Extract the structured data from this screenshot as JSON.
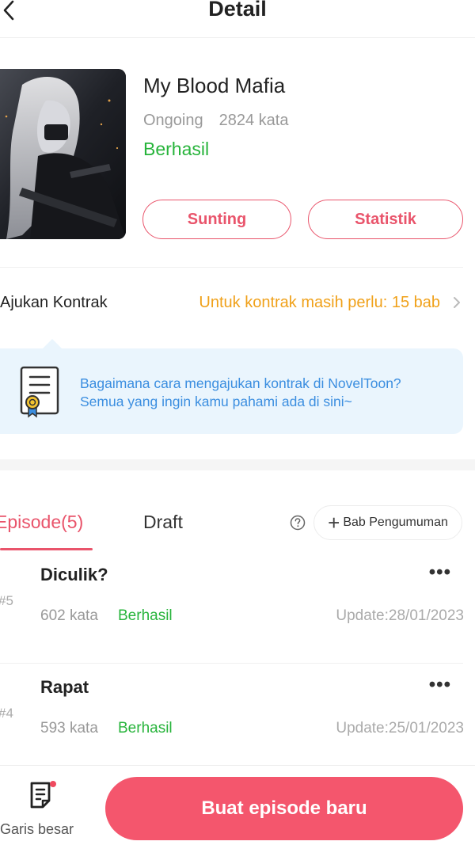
{
  "header": {
    "title": "Detail"
  },
  "book": {
    "title": "My Blood Mafia",
    "state": "Ongoing",
    "word_count": "2824 kata",
    "status": "Berhasil",
    "edit_label": "Sunting",
    "stats_label": "Statistik"
  },
  "contract": {
    "label": "Ajukan Kontrak",
    "requirement": "Untuk kontrak masih perlu: 15 bab"
  },
  "info": {
    "line1": "Bagaimana cara mengajukan kontrak di NovelToon?",
    "line2": "Semua yang ingin kamu pahami ada di sini~"
  },
  "tabs": {
    "episode": "Episode(5)",
    "draft": "Draft",
    "announcement": "Bab Pengumuman"
  },
  "episodes": [
    {
      "number": "#5",
      "title": "Diculik?",
      "words": "602 kata",
      "status": "Berhasil",
      "update": "Update:28/01/2023"
    },
    {
      "number": "#4",
      "title": "Rapat",
      "words": "593 kata",
      "status": "Berhasil",
      "update": "Update:25/01/2023"
    }
  ],
  "bottom": {
    "outline_label": "Garis besar",
    "create_label": "Buat episode baru"
  },
  "colors": {
    "accent": "#e9546b",
    "success": "#27b43b",
    "warning": "#f0a11a",
    "link": "#3b8ee0",
    "primary_button": "#f4566d"
  }
}
